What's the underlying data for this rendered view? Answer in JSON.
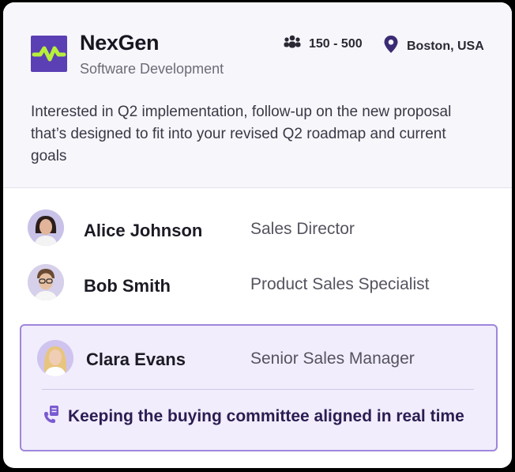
{
  "company": {
    "name": "NexGen",
    "industry": "Software Development",
    "size": "150 - 500",
    "location": "Boston, USA",
    "description": "Interested in Q2 implementation, follow-up on the new proposal that’s designed to fit into your revised Q2 roadmap and current goals"
  },
  "contacts": [
    {
      "name": "Alice Johnson",
      "role": "Sales Director"
    },
    {
      "name": "Bob Smith",
      "role": "Product Sales Specialist"
    },
    {
      "name": "Clara Evans",
      "role": "Senior Sales Manager",
      "note": "Keeping the buying committee aligned in real time"
    }
  ],
  "colors": {
    "brand": "#5b3fb5",
    "accent": "#b7f03a",
    "highlight_bg": "#f1edfc",
    "highlight_border": "#9f86dd"
  },
  "icons": {
    "logo": "nexgen-logo-icon",
    "size": "people-group-icon",
    "location": "map-pin-icon",
    "note": "phone-note-icon"
  }
}
